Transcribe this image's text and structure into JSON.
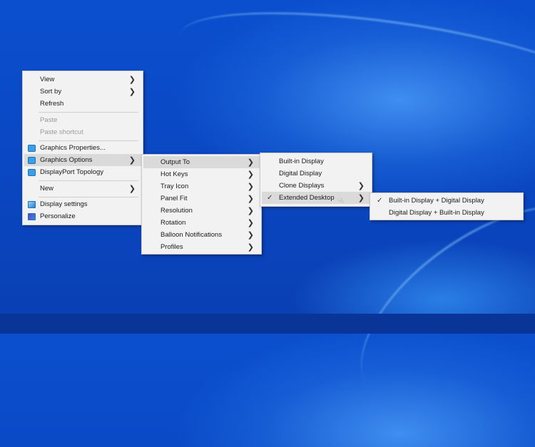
{
  "main_menu": {
    "items": [
      {
        "label": "View",
        "submenu": true
      },
      {
        "label": "Sort by",
        "submenu": true
      },
      {
        "label": "Refresh"
      },
      {
        "label": "Paste",
        "disabled": true
      },
      {
        "label": "Paste shortcut",
        "disabled": true
      },
      {
        "label": "Graphics Properties...",
        "icon": "intel-graphics-icon"
      },
      {
        "label": "Graphics Options",
        "icon": "intel-graphics-icon",
        "submenu": true,
        "highlighted": true
      },
      {
        "label": "DisplayPort Topology",
        "icon": "intel-graphics-icon"
      },
      {
        "label": "New",
        "submenu": true
      },
      {
        "label": "Display settings",
        "icon": "display-settings-icon"
      },
      {
        "label": "Personalize",
        "icon": "personalize-icon"
      }
    ]
  },
  "graphics_options_menu": {
    "items": [
      {
        "label": "Output To",
        "highlighted": true
      },
      {
        "label": "Hot Keys"
      },
      {
        "label": "Tray Icon"
      },
      {
        "label": "Panel Fit"
      },
      {
        "label": "Resolution"
      },
      {
        "label": "Rotation"
      },
      {
        "label": "Balloon Notifications"
      },
      {
        "label": "Profiles"
      }
    ]
  },
  "output_to_menu": {
    "items": [
      {
        "label": "Built-in Display"
      },
      {
        "label": "Digital Display"
      },
      {
        "label": "Clone Displays",
        "submenu": true
      },
      {
        "label": "Extended Desktop",
        "submenu": true,
        "checked": true,
        "highlighted": true
      }
    ]
  },
  "extended_desktop_menu": {
    "items": [
      {
        "label": "Built-in Display + Digital Display",
        "checked": true
      },
      {
        "label": "Digital Display + Built-in Display"
      }
    ]
  }
}
